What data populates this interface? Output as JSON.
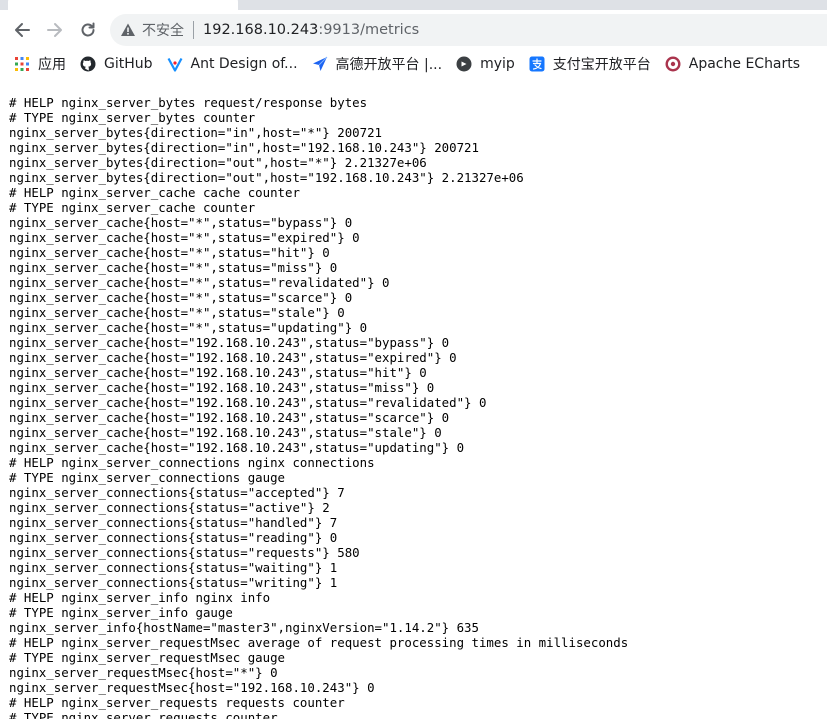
{
  "toolbar": {
    "security_text": "不安全",
    "url_host": "192.168.10.243",
    "url_rest": ":9913/metrics"
  },
  "bookmarks": [
    {
      "label": "应用",
      "icon": "apps-grid-icon"
    },
    {
      "label": "GitHub",
      "icon": "github-icon"
    },
    {
      "label": "Ant Design of...",
      "icon": "antdesign-icon"
    },
    {
      "label": "高德开放平台 |...",
      "icon": "amap-icon"
    },
    {
      "label": "myip",
      "icon": "myip-icon"
    },
    {
      "label": "支付宝开放平台",
      "icon": "alipay-icon"
    },
    {
      "label": "Apache ECharts",
      "icon": "echarts-icon"
    }
  ],
  "colors": {
    "tabstrip": "#dee1e6",
    "omnibox": "#f1f3f4",
    "github": "#24292e",
    "antdesign": "#1890ff",
    "amap": "#1c63f2",
    "alipay": "#1677ff",
    "echarts": "#aa344d"
  },
  "lines": [
    "# HELP nginx_server_bytes request/response bytes",
    "# TYPE nginx_server_bytes counter",
    "nginx_server_bytes{direction=\"in\",host=\"*\"} 200721",
    "nginx_server_bytes{direction=\"in\",host=\"192.168.10.243\"} 200721",
    "nginx_server_bytes{direction=\"out\",host=\"*\"} 2.21327e+06",
    "nginx_server_bytes{direction=\"out\",host=\"192.168.10.243\"} 2.21327e+06",
    "# HELP nginx_server_cache cache counter",
    "# TYPE nginx_server_cache counter",
    "nginx_server_cache{host=\"*\",status=\"bypass\"} 0",
    "nginx_server_cache{host=\"*\",status=\"expired\"} 0",
    "nginx_server_cache{host=\"*\",status=\"hit\"} 0",
    "nginx_server_cache{host=\"*\",status=\"miss\"} 0",
    "nginx_server_cache{host=\"*\",status=\"revalidated\"} 0",
    "nginx_server_cache{host=\"*\",status=\"scarce\"} 0",
    "nginx_server_cache{host=\"*\",status=\"stale\"} 0",
    "nginx_server_cache{host=\"*\",status=\"updating\"} 0",
    "nginx_server_cache{host=\"192.168.10.243\",status=\"bypass\"} 0",
    "nginx_server_cache{host=\"192.168.10.243\",status=\"expired\"} 0",
    "nginx_server_cache{host=\"192.168.10.243\",status=\"hit\"} 0",
    "nginx_server_cache{host=\"192.168.10.243\",status=\"miss\"} 0",
    "nginx_server_cache{host=\"192.168.10.243\",status=\"revalidated\"} 0",
    "nginx_server_cache{host=\"192.168.10.243\",status=\"scarce\"} 0",
    "nginx_server_cache{host=\"192.168.10.243\",status=\"stale\"} 0",
    "nginx_server_cache{host=\"192.168.10.243\",status=\"updating\"} 0",
    "# HELP nginx_server_connections nginx connections",
    "# TYPE nginx_server_connections gauge",
    "nginx_server_connections{status=\"accepted\"} 7",
    "nginx_server_connections{status=\"active\"} 2",
    "nginx_server_connections{status=\"handled\"} 7",
    "nginx_server_connections{status=\"reading\"} 0",
    "nginx_server_connections{status=\"requests\"} 580",
    "nginx_server_connections{status=\"waiting\"} 1",
    "nginx_server_connections{status=\"writing\"} 1",
    "# HELP nginx_server_info nginx info",
    "# TYPE nginx_server_info gauge",
    "nginx_server_info{hostName=\"master3\",nginxVersion=\"1.14.2\"} 635",
    "# HELP nginx_server_requestMsec average of request processing times in milliseconds",
    "# TYPE nginx_server_requestMsec gauge",
    "nginx_server_requestMsec{host=\"*\"} 0",
    "nginx_server_requestMsec{host=\"192.168.10.243\"} 0",
    "# HELP nginx_server_requests requests counter",
    "# TYPE nginx_server_requests counter"
  ]
}
